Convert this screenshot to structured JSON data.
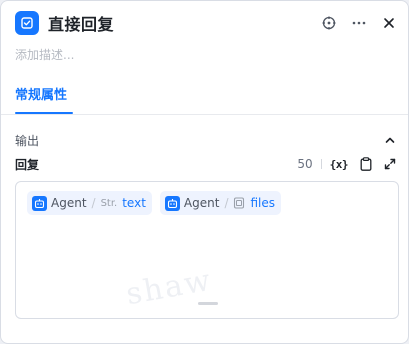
{
  "node": {
    "title": "直接回复",
    "description_placeholder": "添加描述..."
  },
  "icons": {
    "node": "reply-node-icon",
    "target": "crosshair-icon",
    "more": "more-horizontal-icon",
    "close": "close-icon",
    "collapse": "chevron-up-icon",
    "variable": "variable-braces-icon",
    "copy": "clipboard-icon",
    "expand": "expand-icon",
    "agent": "agent-bot-icon",
    "file": "file-icon"
  },
  "tabs": [
    {
      "label": "常规属性",
      "active": true
    }
  ],
  "output_section": {
    "label": "输出",
    "collapsed": false
  },
  "reply_field": {
    "label": "回复",
    "count": "50",
    "variable_button_label": "{x}",
    "chips": [
      {
        "node": "Agent",
        "type": "Str.",
        "variable": "text"
      },
      {
        "node": "Agent",
        "type": "",
        "variable": "files"
      }
    ],
    "watermark": "shaw"
  },
  "colors": {
    "accent": "#1677ff",
    "chip_background": "#eef3fe",
    "border": "#d9dde5"
  }
}
